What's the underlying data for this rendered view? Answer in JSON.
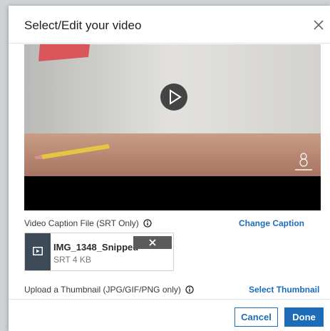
{
  "dialog": {
    "title": "Select/Edit your video",
    "close_icon": "close-icon"
  },
  "video": {
    "play_icon": "play-icon",
    "watermark_icon": "logo-watermark"
  },
  "caption": {
    "label": "Video Caption File (SRT Only)",
    "info_icon": "info-icon",
    "change_link": "Change Caption",
    "file": {
      "name": "IMG_1348_Snipped",
      "size": "SRT 4 KB",
      "thumb_icon": "video-file-icon",
      "remove_icon": "close-icon"
    }
  },
  "thumbnail": {
    "label": "Upload a Thumbnail (JPG/GIF/PNG only)",
    "info_icon": "info-icon",
    "select_link": "Select Thumbnail"
  },
  "footer": {
    "cancel_label": "Cancel",
    "done_label": "Done"
  },
  "colors": {
    "accent": "#1c6cb8",
    "file_thumb_bg": "#3d4b59",
    "remove_btn_bg": "#5b5b5b"
  }
}
